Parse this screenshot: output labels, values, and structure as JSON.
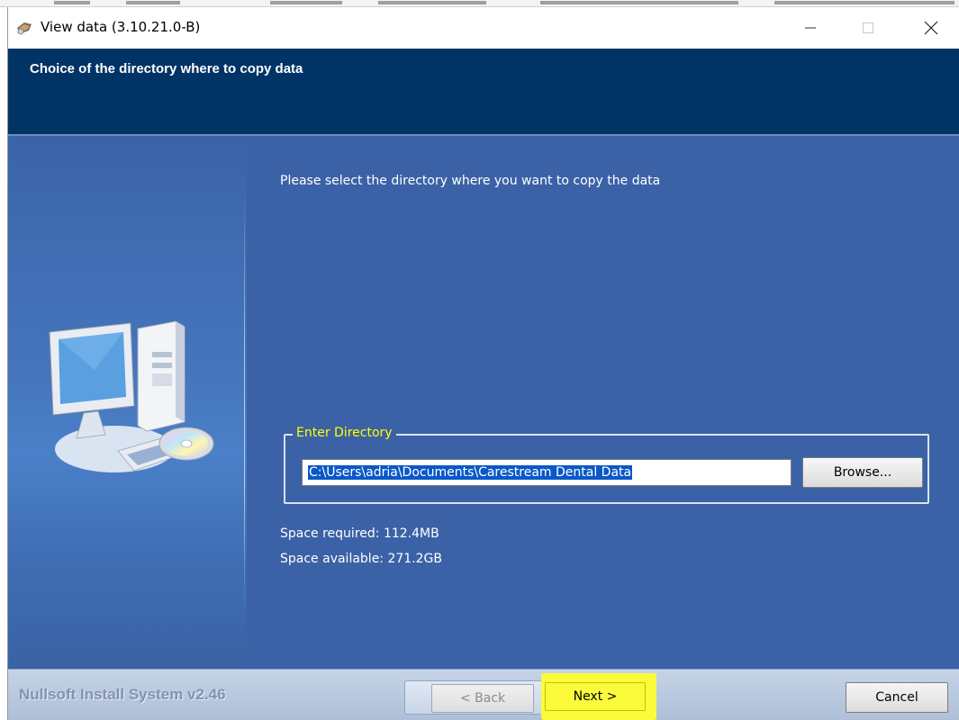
{
  "window": {
    "title": "View data (3.10.21.0-B)",
    "app_icon": "nsis-installer-icon",
    "controls": [
      "minimize-icon",
      "maximize-icon",
      "close-icon"
    ]
  },
  "header": {
    "title": "Choice of the directory where to copy data"
  },
  "main": {
    "instruction": "Please select the directory where you want to copy the data",
    "directory_group": {
      "legend": "Enter Directory",
      "path_value": "C:\\Users\\adria\\Documents\\Carestream Dental Data",
      "browse_label": "Browse..."
    },
    "space_required": "Space required: 112.4MB",
    "space_available": "Space available: 271.2GB",
    "art_icon": "computer-with-cd-icon"
  },
  "footer": {
    "brand": "Nullsoft Install System v2.46",
    "back_label": "< Back",
    "next_label": "Next >",
    "cancel_label": "Cancel"
  },
  "colors": {
    "header_bg": "#003366",
    "body_bg": "#3b62a6",
    "legend_text": "#ffff00",
    "selection_bg": "#0a58c8",
    "next_highlight": "#fbfb3c"
  }
}
